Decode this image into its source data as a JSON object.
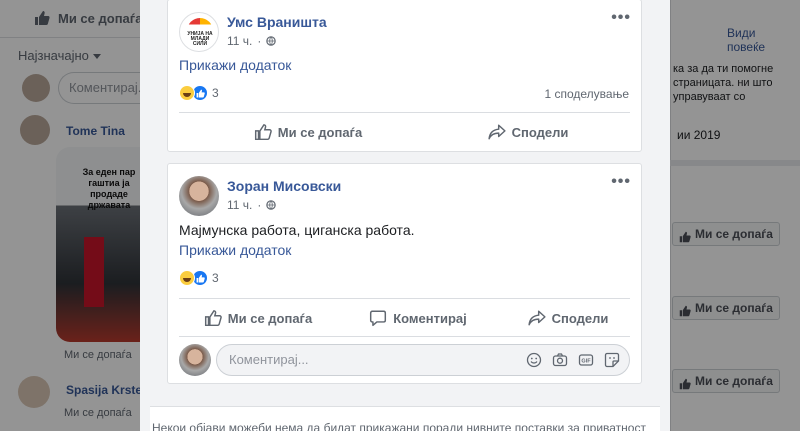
{
  "background": {
    "like_bar_label": "Ми се допаѓа",
    "sort_label": "Најзначајно",
    "comment_placeholder": "Коментирај...",
    "author_1": "Tome Tina",
    "photo_caption": "За еден пар гаштиа ја продаде државата",
    "like_link_1": "Ми се допаѓа",
    "author_2": "Spasija Krste",
    "like_link_2": "Ми се допаѓа",
    "right_see_more": "Види повеќе",
    "right_text": "ка за да ти помогне страницата. ни што управуваат со",
    "right_year": "ии 2019",
    "right_like_button": "Ми се допаѓа"
  },
  "post_1": {
    "author": "Умс Враништа",
    "avatar_text": "УНИЈА НА МЛАДИ СИЛИ",
    "time": "11 ч.",
    "translate_link": "Прикажи додаток",
    "reaction_count": "3",
    "shares": "1 споделување",
    "like_label": "Ми се допаѓа",
    "share_label": "Сподели"
  },
  "post_2": {
    "author": "Зоран Мисовски",
    "time": "11 ч.",
    "text": "Мајмунска работа, циганска работа.",
    "translate_link": "Прикажи додаток",
    "reaction_count": "3",
    "like_label": "Ми се допаѓа",
    "comment_label": "Коментирај",
    "share_label": "Сподели",
    "comment_placeholder": "Коментирај..."
  },
  "privacy_notice": "Некои објави можеби нема да бидат прикажани поради нивните поставки за приватност",
  "colors": {
    "link_blue": "#385898",
    "like_blue": "#1877f2",
    "haha_yellow": "#fbcd3f"
  }
}
